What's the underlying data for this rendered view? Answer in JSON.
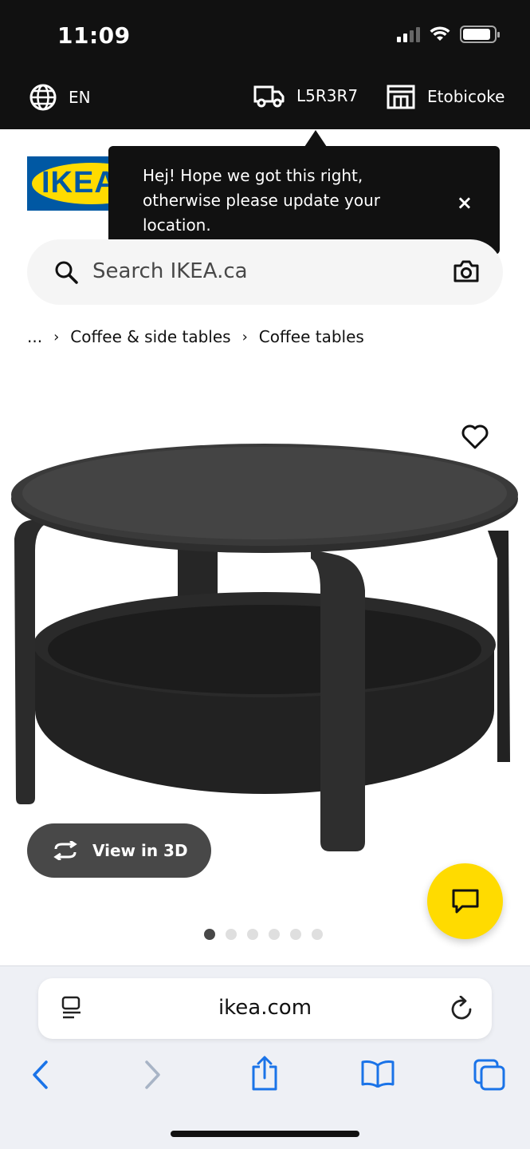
{
  "status_bar": {
    "time": "11:09",
    "battery_level": 0.9
  },
  "top_bar": {
    "language": "EN",
    "postal_code": "L5R3R7",
    "store": "Etobicoke"
  },
  "logo": {
    "text": "IKEA"
  },
  "tooltip": {
    "message": "Hej! Hope we got this right, otherwise please update your location.",
    "close_label": "×"
  },
  "search": {
    "placeholder": "Search IKEA.ca"
  },
  "breadcrumb": {
    "ellipsis": "...",
    "items": [
      "Coffee & side tables",
      "Coffee tables"
    ]
  },
  "product": {
    "view_3d_label": "View in 3D",
    "image_count": 6,
    "active_image_index": 0
  },
  "safari": {
    "url": "ikea.com"
  },
  "colors": {
    "ikea_blue": "#0058a3",
    "ikea_yellow": "#ffdb00",
    "ios_blue": "#1a73e8",
    "dark": "#111111"
  }
}
